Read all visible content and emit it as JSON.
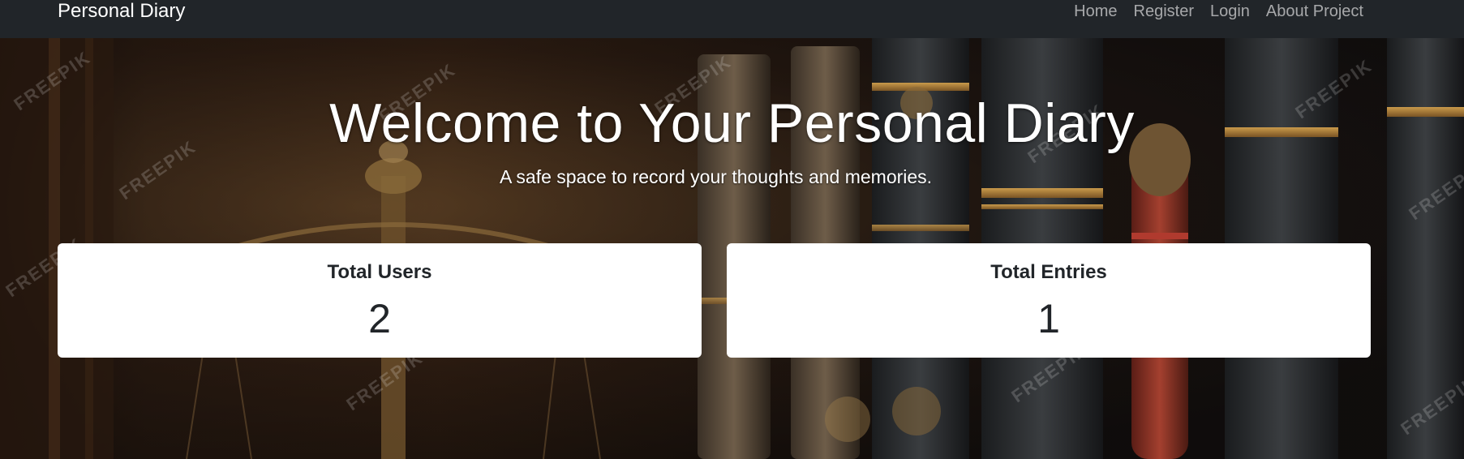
{
  "navbar": {
    "brand": "Personal Diary",
    "links": [
      "Home",
      "Register",
      "Login",
      "About Project"
    ]
  },
  "hero": {
    "title": "Welcome to Your Personal Diary",
    "subtitle": "A safe space to record your thoughts and memories.",
    "watermark": "FREEPIK"
  },
  "stats": [
    {
      "label": "Total Users",
      "value": "2"
    },
    {
      "label": "Total Entries",
      "value": "1"
    }
  ],
  "colors": {
    "navbar_bg": "#212529",
    "card_bg": "#ffffff",
    "text_dark": "#212529"
  }
}
